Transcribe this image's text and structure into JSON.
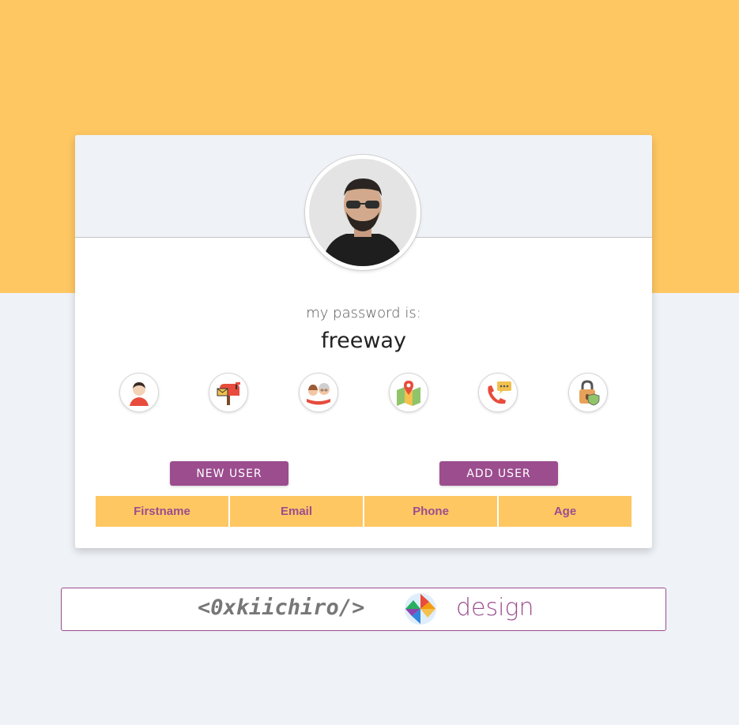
{
  "profile": {
    "label": "my password is:",
    "value": "freeway"
  },
  "icons": [
    {
      "name": "user-icon"
    },
    {
      "name": "mailbox-icon"
    },
    {
      "name": "age-icon"
    },
    {
      "name": "map-location-icon"
    },
    {
      "name": "phone-icon"
    },
    {
      "name": "password-lock-icon"
    }
  ],
  "actions": {
    "new_user": "NEW USER",
    "add_user": "ADD USER"
  },
  "table": {
    "columns": [
      "Firstname",
      "Email",
      "Phone",
      "Age"
    ]
  },
  "footer": {
    "code": "<0xkiichiro/>",
    "word": "design"
  },
  "colors": {
    "accent": "#9b4d8e",
    "band": "#fec762",
    "background": "#eff2f7"
  }
}
